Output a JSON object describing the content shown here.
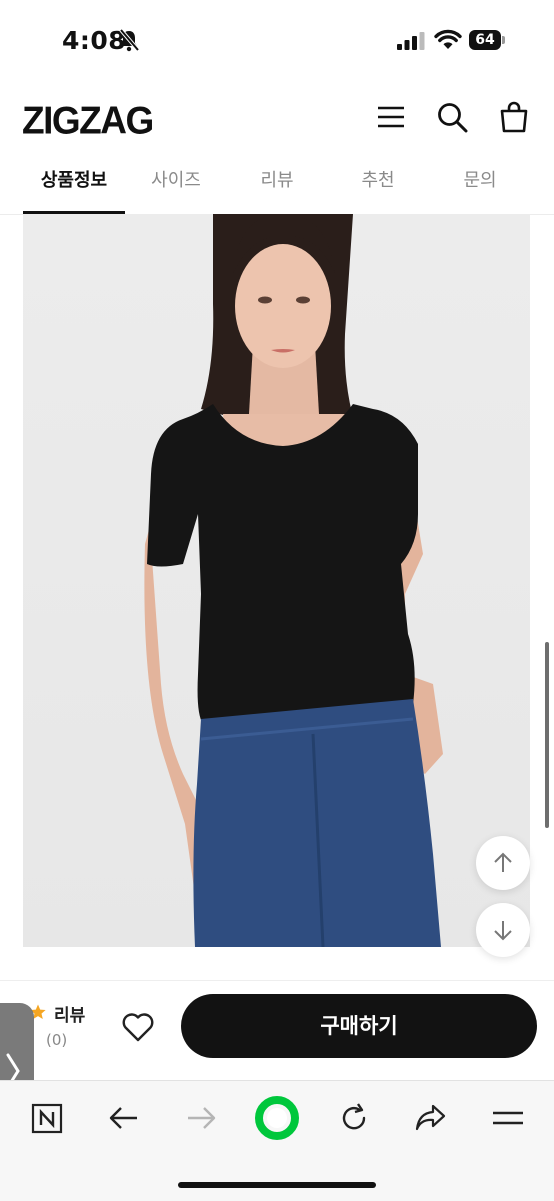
{
  "status_bar": {
    "time": "4:08",
    "battery": "64"
  },
  "header": {
    "logo": "ZIGZAG",
    "icons": [
      "menu-icon",
      "search-icon",
      "cart-icon"
    ]
  },
  "tabs": [
    {
      "label": "상품정보",
      "active": true
    },
    {
      "label": "사이즈",
      "active": false
    },
    {
      "label": "리뷰",
      "active": false
    },
    {
      "label": "추천",
      "active": false
    },
    {
      "label": "문의",
      "active": false
    }
  ],
  "product": {
    "image_icon": "product-photo"
  },
  "purchase_bar": {
    "review_label": "리뷰",
    "review_count": "(0)",
    "buy_label": "구매하기"
  },
  "browser_toolbar": {
    "icons": [
      "naver-icon",
      "back-icon",
      "forward-icon",
      "green-circle-icon",
      "reload-icon",
      "share-icon",
      "hamburger-icon"
    ]
  },
  "colors": {
    "accent": "#111111",
    "star": "#f5a623",
    "green": "#00c73c"
  }
}
